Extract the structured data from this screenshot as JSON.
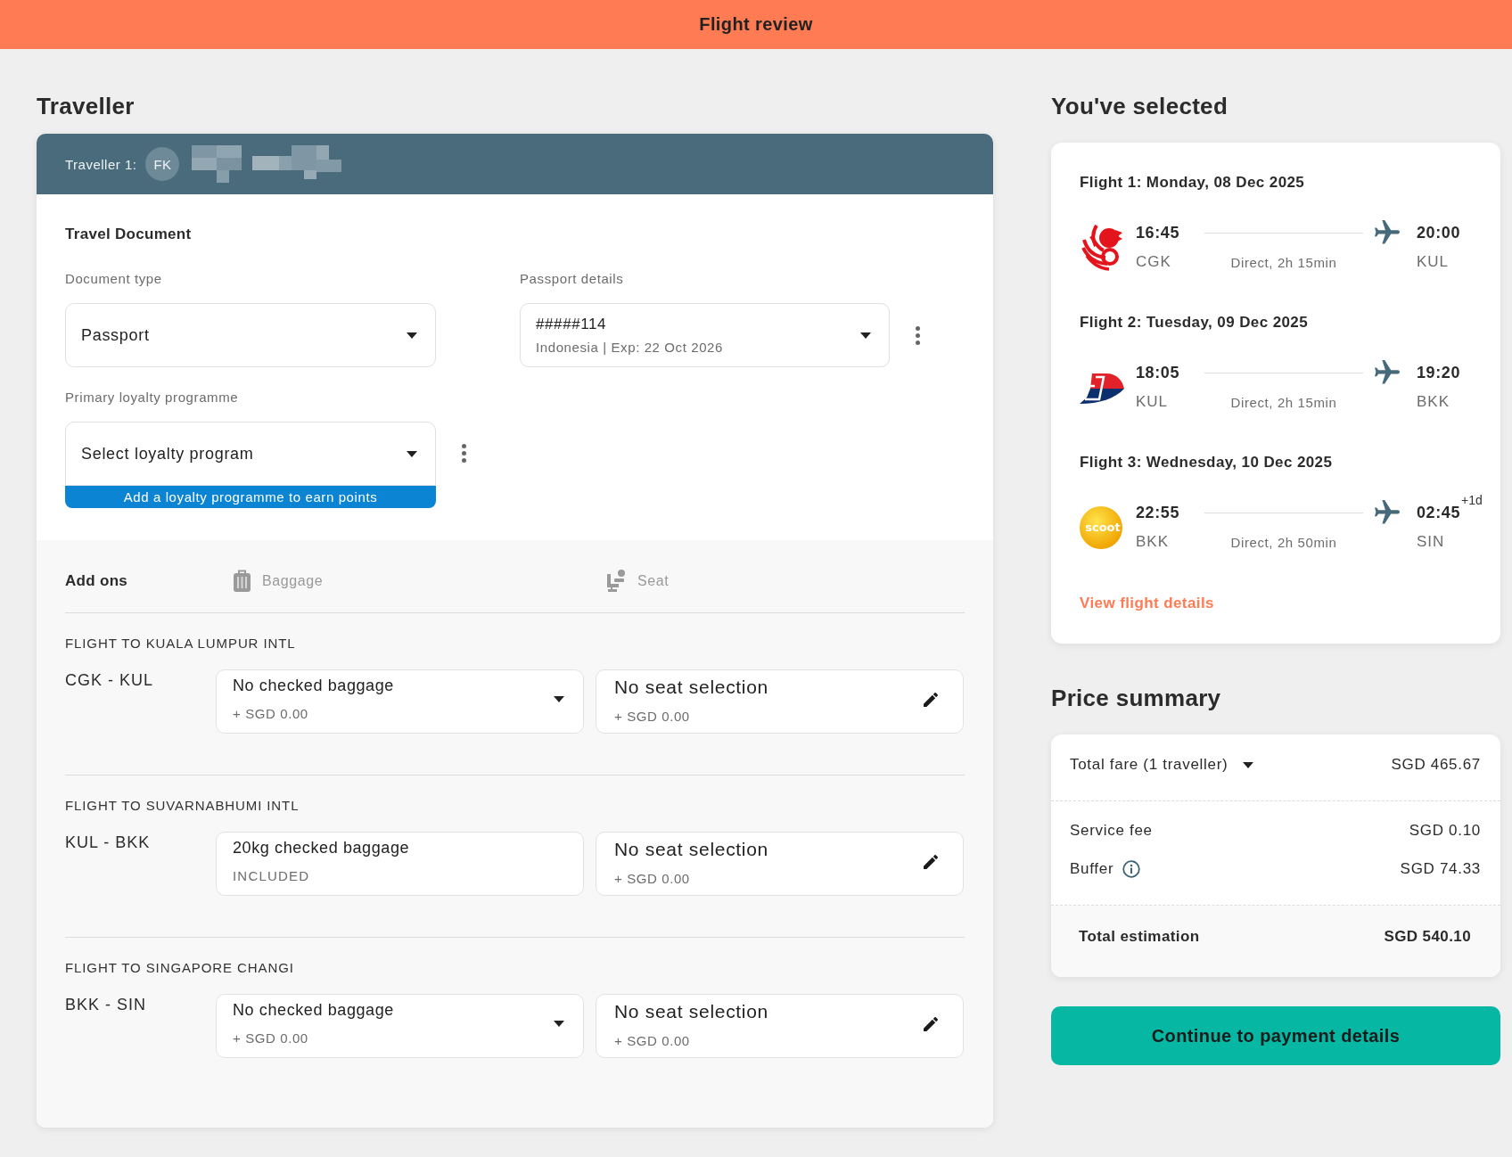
{
  "header": {
    "title": "Flight review"
  },
  "traveller_section": {
    "title": "Traveller",
    "traveller_label": "Traveller 1:",
    "initials": "FK",
    "travel_document": {
      "title": "Travel Document",
      "document_type": {
        "label": "Document type",
        "value": "Passport"
      },
      "passport_details": {
        "label": "Passport details",
        "value": "#####114",
        "detail": "Indonesia | Exp: 22 Oct 2026"
      },
      "loyalty": {
        "label": "Primary loyalty programme",
        "placeholder": "Select loyalty program",
        "hint": "Add a loyalty programme to earn points"
      }
    },
    "add_ons": {
      "title": "Add ons",
      "columns": [
        {
          "kind": "baggage",
          "label": "Baggage"
        },
        {
          "kind": "seat",
          "label": "Seat"
        }
      ],
      "flights": [
        {
          "heading": "FLIGHT TO KUALA LUMPUR INTL",
          "route": "CGK - KUL",
          "baggage": {
            "kind": "select",
            "title": "No checked baggage",
            "subtitle": "+ SGD 0.00"
          },
          "seat": {
            "title": "No seat selection",
            "subtitle": "+ SGD 0.00"
          }
        },
        {
          "heading": "FLIGHT TO SUVARNABHUMI INTL",
          "route": "KUL - BKK",
          "baggage": {
            "kind": "included",
            "title": "20kg checked baggage",
            "subtitle": "INCLUDED"
          },
          "seat": {
            "title": "No seat selection",
            "subtitle": "+ SGD 0.00"
          }
        },
        {
          "heading": "FLIGHT TO SINGAPORE CHANGI",
          "route": "BKK - SIN",
          "baggage": {
            "kind": "select",
            "title": "No checked baggage",
            "subtitle": "+ SGD 0.00"
          },
          "seat": {
            "title": "No seat selection",
            "subtitle": "+ SGD 0.00"
          }
        }
      ]
    }
  },
  "selected": {
    "title": "You've selected",
    "flights": [
      {
        "title": "Flight 1: Monday, 08 Dec 2025",
        "kind": "bird",
        "departure_time": "16:45",
        "departure_airport": "CGK",
        "duration": "Direct, 2h 15min",
        "arrival_time": "20:00",
        "arrival_airport": "KUL"
      },
      {
        "title": "Flight 2: Tuesday, 09 Dec 2025",
        "kind": "wing",
        "departure_time": "18:05",
        "departure_airport": "KUL",
        "duration": "Direct, 2h 15min",
        "arrival_time": "19:20",
        "arrival_airport": "BKK"
      },
      {
        "title": "Flight 3: Wednesday, 10 Dec 2025",
        "kind": "ball",
        "logo_text": "scoot",
        "departure_time": "22:55",
        "departure_airport": "BKK",
        "duration": "Direct, 2h 50min",
        "arrival_time": "02:45",
        "day_offset": "+1d",
        "arrival_airport": "SIN"
      }
    ],
    "link": "View flight details"
  },
  "price_summary": {
    "title": "Price summary",
    "total_fare": {
      "label": "Total fare (1 traveller)",
      "amount": "SGD 465.67"
    },
    "fees": [
      {
        "label": "Service fee",
        "amount": "SGD 0.10",
        "info": false
      },
      {
        "label": "Buffer",
        "amount": "SGD 74.33",
        "info": true
      }
    ],
    "total": {
      "label": "Total estimation",
      "amount": "SGD 540.10"
    }
  },
  "continue_button": {
    "label": "Continue to payment details"
  }
}
